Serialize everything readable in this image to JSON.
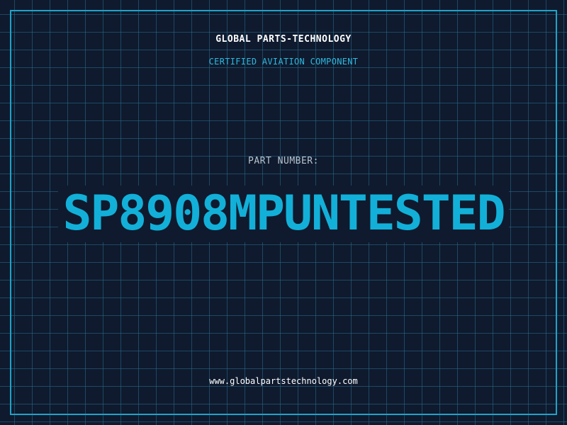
{
  "header": {
    "company_name": "GLOBAL PARTS-TECHNOLOGY",
    "subtitle": "CERTIFIED AVIATION COMPONENT"
  },
  "part": {
    "label": "PART NUMBER:",
    "number": "SP8908MPUNTESTED"
  },
  "footer": {
    "website": "www.globalpartstechnology.com"
  },
  "colors": {
    "background": "#0f1a2e",
    "grid": "#286e8c",
    "accent": "#12b0d8",
    "frame": "#1fa3c8",
    "text_primary": "#ffffff",
    "text_muted": "#b9c3cf"
  }
}
